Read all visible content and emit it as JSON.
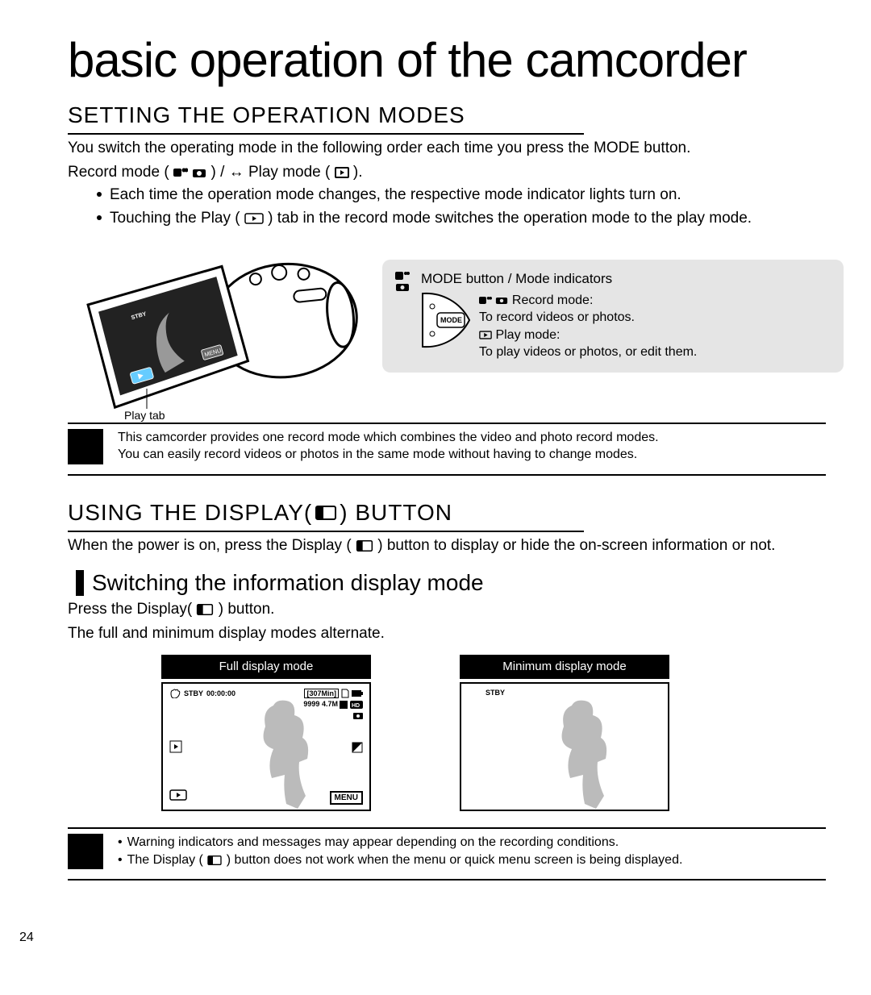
{
  "title": "basic operation of the camcorder",
  "page_number": "24",
  "section1": {
    "heading": "SETTING THE OPERATION MODES",
    "para": "You switch the operating mode in the following order each time you press the MODE button.",
    "mode_line_pre": "Record mode (",
    "mode_line_mid": ") / ↔ Play mode (",
    "mode_line_post": ").",
    "bullet1": "Each time the operation mode changes, the respective mode indicator lights turn on.",
    "bullet2a": "Touching the Play (",
    "bullet2b": ") tab in the record mode switches the operation mode to the play mode."
  },
  "figure1": {
    "play_tab_label": "Play tab",
    "infobox_title": "MODE button / Mode indicators",
    "record_label": "Record mode:",
    "record_desc": "To record videos or photos.",
    "play_label": "Play mode:",
    "play_desc": "To play videos or photos, or edit them.",
    "mode_button_text": "MODE"
  },
  "note1": {
    "line1": "This camcorder provides one record mode which combines the video and photo record modes.",
    "line2": "You can easily record videos or photos in the same mode without having to change modes."
  },
  "section2": {
    "heading_pre": "USING THE DISPLAY(",
    "heading_post": ") BUTTON",
    "para_a": "When the power is on, press the Display (",
    "para_b": ") button to display or hide the on-screen information or not.",
    "subheading": "Switching the information display mode",
    "step_a": "Press the Display(",
    "step_b": ") button.",
    "step2": "The full and minimum display modes alternate.",
    "full_title": "Full display mode",
    "min_title": "Minimum display mode"
  },
  "screen_full": {
    "stby": "STBY",
    "time": "00:00:00",
    "remain": "[307Min]",
    "count": "9999",
    "res": "4.7M",
    "menu": "MENU"
  },
  "screen_min": {
    "stby": "STBY"
  },
  "note2": {
    "b1": "Warning indicators and messages may appear depending on the recording conditions.",
    "b2a": "The Display (",
    "b2b": ") button does not work when the menu or quick menu screen is being displayed."
  }
}
